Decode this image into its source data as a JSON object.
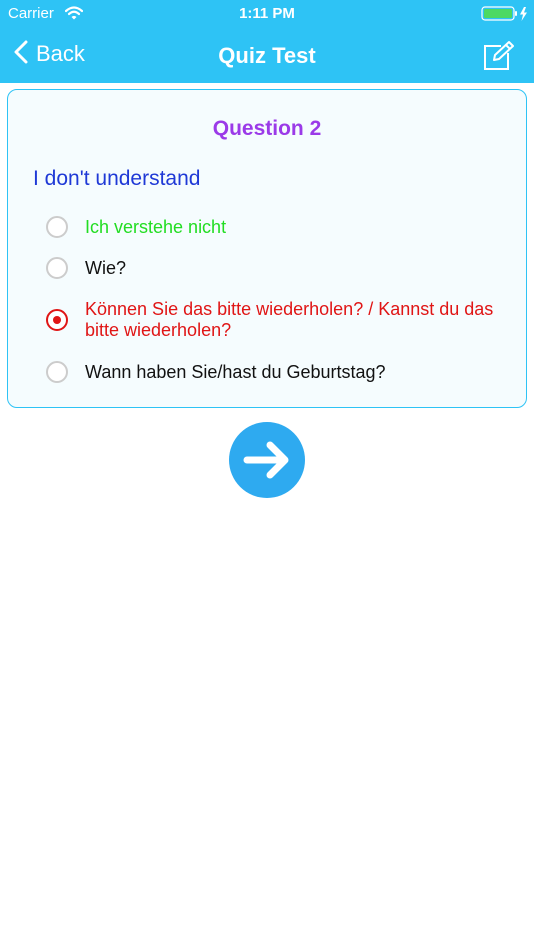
{
  "status": {
    "carrier": "Carrier",
    "time": "1:11 PM"
  },
  "nav": {
    "back_label": "Back",
    "title": "Quiz Test"
  },
  "quiz": {
    "question_number": "Question 2",
    "question": "I don't understand",
    "options": [
      {
        "label": "Ich verstehe nicht",
        "state": "correct"
      },
      {
        "label": "Wie?",
        "state": "none"
      },
      {
        "label": "Können Sie das bitte wiederholen? / Kannst du das bitte wiederholen?",
        "state": "selected-wrong"
      },
      {
        "label": "Wann haben Sie/hast du Geburtstag?",
        "state": "none"
      }
    ]
  },
  "colors": {
    "header": "#2ec3f5",
    "question_number": "#9b3ae8",
    "question_text": "#1f39d6",
    "correct": "#22dd22",
    "wrong": "#e01515",
    "next_button": "#2eaaf0"
  }
}
